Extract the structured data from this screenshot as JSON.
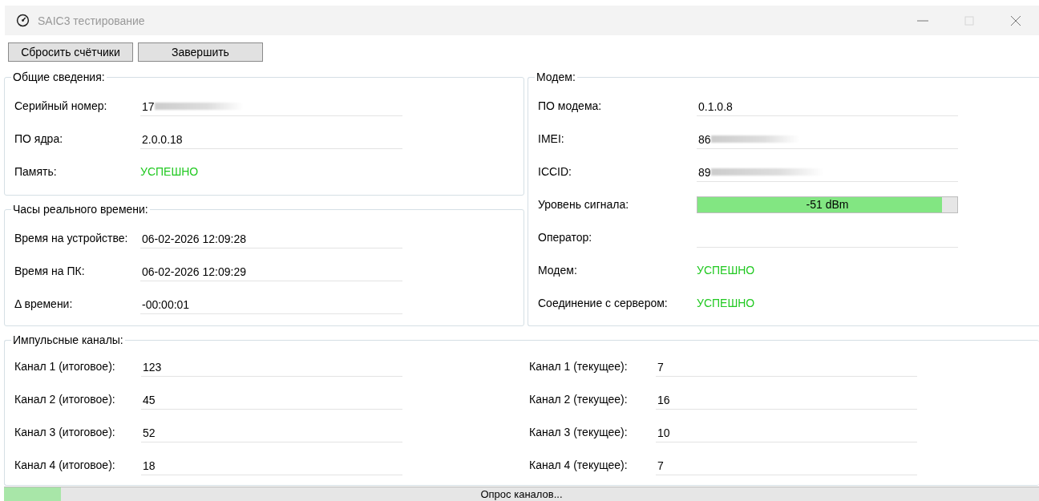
{
  "window": {
    "title": "SAIC3 тестирование",
    "maximize_disabled": true
  },
  "toolbar": [
    "Сбросить счётчики",
    "Завершить"
  ],
  "general": {
    "title": "Общие сведения:",
    "rows": [
      {
        "kind": "field",
        "label": "Серийный номер:",
        "value": "17",
        "redacted": true
      },
      {
        "kind": "field",
        "label": "ПО ядра:",
        "value": "2.0.0.18"
      },
      {
        "kind": "status",
        "label": "Память:",
        "value": "УСПЕШНО"
      }
    ]
  },
  "clock": {
    "title": "Часы реального времени:",
    "rows": [
      {
        "kind": "field",
        "label": "Время на устройстве:",
        "value": "06-02-2026 12:09:28"
      },
      {
        "kind": "field",
        "label": "Время на ПК:",
        "value": "06-02-2026 12:09:29"
      },
      {
        "kind": "field",
        "label": "Δ времени:",
        "value": "-00:00:01"
      }
    ]
  },
  "modem": {
    "title": "Модем:",
    "rows": [
      {
        "kind": "field",
        "label": "ПО модема:",
        "value": "0.1.0.8"
      },
      {
        "kind": "field",
        "label": "IMEI:",
        "value": "86",
        "redacted": true
      },
      {
        "kind": "field",
        "label": "ICCID:",
        "value": "89",
        "redacted": true
      },
      {
        "kind": "meter",
        "label": "Уровень сигнала:",
        "level": 0.94,
        "reading": "-51 dBm"
      },
      {
        "kind": "field",
        "label": "Оператор:"
      },
      {
        "kind": "status",
        "label": "Модем:",
        "value": "УСПЕШНО"
      },
      {
        "kind": "status",
        "label": "Соединение с сервером:",
        "value": "УСПЕШНО"
      }
    ]
  },
  "pulse": {
    "title": "Импульсные каналы:",
    "columns": [
      [
        {
          "kind": "field",
          "label": "Канал 1 (итоговое):",
          "value": "123"
        },
        {
          "kind": "field",
          "label": "Канал 2 (итоговое):",
          "value": "45"
        },
        {
          "kind": "field",
          "label": "Канал 3 (итоговое):",
          "value": "52"
        },
        {
          "kind": "field",
          "label": "Канал 4 (итоговое):",
          "value": "18"
        }
      ],
      [
        {
          "kind": "field",
          "label": "Канал 1 (текущее):",
          "value": "7"
        },
        {
          "kind": "field",
          "label": "Канал 2 (текущее):",
          "value": "16"
        },
        {
          "kind": "field",
          "label": "Канал 3 (текущее):",
          "value": "10"
        },
        {
          "kind": "field",
          "label": "Канал 4 (текущее):",
          "value": "7"
        }
      ]
    ]
  },
  "status_bar": {
    "level": 0.055,
    "text": "Опрос каналов..."
  }
}
